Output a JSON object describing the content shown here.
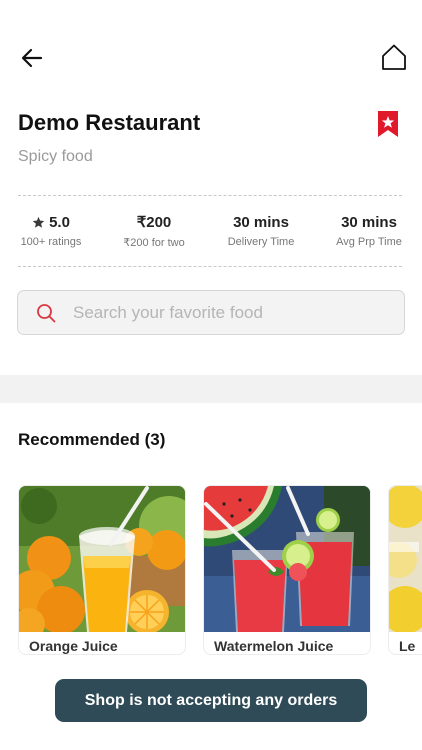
{
  "header": {
    "back_icon": "arrow-left-icon",
    "home_icon": "home-icon"
  },
  "restaurant": {
    "name": "Demo Restaurant",
    "cuisine": "Spicy food",
    "bookmark_icon": "bookmark-icon",
    "bookmark_color": "#e0192b"
  },
  "stats": [
    {
      "value": "5.0",
      "label": "100+ ratings",
      "icon": "star-icon"
    },
    {
      "value": "₹200",
      "label": "₹200 for two"
    },
    {
      "value": "30 mins",
      "label": "Delivery Time"
    },
    {
      "value": "30 mins",
      "label": "Avg Prp Time"
    }
  ],
  "search": {
    "placeholder": "Search your favorite food",
    "icon": "search-icon",
    "icon_color": "#d9363e"
  },
  "recommended": {
    "title": "Recommended (3)",
    "items": [
      {
        "name": "Orange Juice"
      },
      {
        "name": "Watermelon Juice"
      },
      {
        "name": "Le"
      }
    ]
  },
  "toast": {
    "message": "Shop is not accepting any orders",
    "color": "#2e4b57"
  }
}
